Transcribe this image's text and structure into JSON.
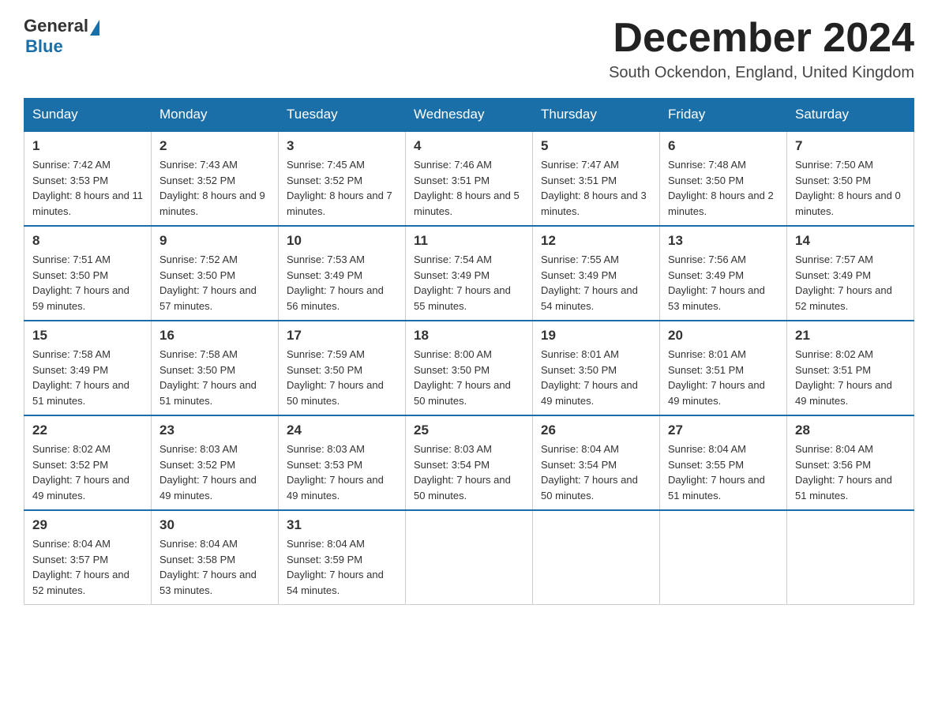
{
  "header": {
    "logo_general": "General",
    "logo_blue": "Blue",
    "month_title": "December 2024",
    "subtitle": "South Ockendon, England, United Kingdom"
  },
  "days_of_week": [
    "Sunday",
    "Monday",
    "Tuesday",
    "Wednesday",
    "Thursday",
    "Friday",
    "Saturday"
  ],
  "weeks": [
    [
      {
        "day": "1",
        "sunrise": "7:42 AM",
        "sunset": "3:53 PM",
        "daylight": "8 hours and 11 minutes."
      },
      {
        "day": "2",
        "sunrise": "7:43 AM",
        "sunset": "3:52 PM",
        "daylight": "8 hours and 9 minutes."
      },
      {
        "day": "3",
        "sunrise": "7:45 AM",
        "sunset": "3:52 PM",
        "daylight": "8 hours and 7 minutes."
      },
      {
        "day": "4",
        "sunrise": "7:46 AM",
        "sunset": "3:51 PM",
        "daylight": "8 hours and 5 minutes."
      },
      {
        "day": "5",
        "sunrise": "7:47 AM",
        "sunset": "3:51 PM",
        "daylight": "8 hours and 3 minutes."
      },
      {
        "day": "6",
        "sunrise": "7:48 AM",
        "sunset": "3:50 PM",
        "daylight": "8 hours and 2 minutes."
      },
      {
        "day": "7",
        "sunrise": "7:50 AM",
        "sunset": "3:50 PM",
        "daylight": "8 hours and 0 minutes."
      }
    ],
    [
      {
        "day": "8",
        "sunrise": "7:51 AM",
        "sunset": "3:50 PM",
        "daylight": "7 hours and 59 minutes."
      },
      {
        "day": "9",
        "sunrise": "7:52 AM",
        "sunset": "3:50 PM",
        "daylight": "7 hours and 57 minutes."
      },
      {
        "day": "10",
        "sunrise": "7:53 AM",
        "sunset": "3:49 PM",
        "daylight": "7 hours and 56 minutes."
      },
      {
        "day": "11",
        "sunrise": "7:54 AM",
        "sunset": "3:49 PM",
        "daylight": "7 hours and 55 minutes."
      },
      {
        "day": "12",
        "sunrise": "7:55 AM",
        "sunset": "3:49 PM",
        "daylight": "7 hours and 54 minutes."
      },
      {
        "day": "13",
        "sunrise": "7:56 AM",
        "sunset": "3:49 PM",
        "daylight": "7 hours and 53 minutes."
      },
      {
        "day": "14",
        "sunrise": "7:57 AM",
        "sunset": "3:49 PM",
        "daylight": "7 hours and 52 minutes."
      }
    ],
    [
      {
        "day": "15",
        "sunrise": "7:58 AM",
        "sunset": "3:49 PM",
        "daylight": "7 hours and 51 minutes."
      },
      {
        "day": "16",
        "sunrise": "7:58 AM",
        "sunset": "3:50 PM",
        "daylight": "7 hours and 51 minutes."
      },
      {
        "day": "17",
        "sunrise": "7:59 AM",
        "sunset": "3:50 PM",
        "daylight": "7 hours and 50 minutes."
      },
      {
        "day": "18",
        "sunrise": "8:00 AM",
        "sunset": "3:50 PM",
        "daylight": "7 hours and 50 minutes."
      },
      {
        "day": "19",
        "sunrise": "8:01 AM",
        "sunset": "3:50 PM",
        "daylight": "7 hours and 49 minutes."
      },
      {
        "day": "20",
        "sunrise": "8:01 AM",
        "sunset": "3:51 PM",
        "daylight": "7 hours and 49 minutes."
      },
      {
        "day": "21",
        "sunrise": "8:02 AM",
        "sunset": "3:51 PM",
        "daylight": "7 hours and 49 minutes."
      }
    ],
    [
      {
        "day": "22",
        "sunrise": "8:02 AM",
        "sunset": "3:52 PM",
        "daylight": "7 hours and 49 minutes."
      },
      {
        "day": "23",
        "sunrise": "8:03 AM",
        "sunset": "3:52 PM",
        "daylight": "7 hours and 49 minutes."
      },
      {
        "day": "24",
        "sunrise": "8:03 AM",
        "sunset": "3:53 PM",
        "daylight": "7 hours and 49 minutes."
      },
      {
        "day": "25",
        "sunrise": "8:03 AM",
        "sunset": "3:54 PM",
        "daylight": "7 hours and 50 minutes."
      },
      {
        "day": "26",
        "sunrise": "8:04 AM",
        "sunset": "3:54 PM",
        "daylight": "7 hours and 50 minutes."
      },
      {
        "day": "27",
        "sunrise": "8:04 AM",
        "sunset": "3:55 PM",
        "daylight": "7 hours and 51 minutes."
      },
      {
        "day": "28",
        "sunrise": "8:04 AM",
        "sunset": "3:56 PM",
        "daylight": "7 hours and 51 minutes."
      }
    ],
    [
      {
        "day": "29",
        "sunrise": "8:04 AM",
        "sunset": "3:57 PM",
        "daylight": "7 hours and 52 minutes."
      },
      {
        "day": "30",
        "sunrise": "8:04 AM",
        "sunset": "3:58 PM",
        "daylight": "7 hours and 53 minutes."
      },
      {
        "day": "31",
        "sunrise": "8:04 AM",
        "sunset": "3:59 PM",
        "daylight": "7 hours and 54 minutes."
      },
      null,
      null,
      null,
      null
    ]
  ],
  "labels": {
    "sunrise": "Sunrise:",
    "sunset": "Sunset:",
    "daylight": "Daylight:"
  }
}
